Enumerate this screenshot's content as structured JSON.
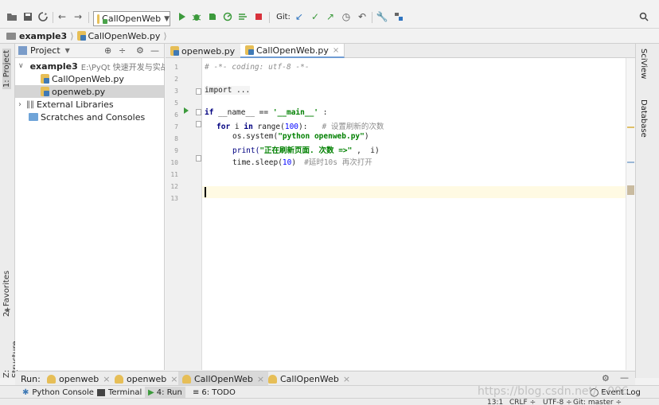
{
  "toolbar": {
    "run_config": "CallOpenWeb",
    "git_label": "Git:",
    "icons": [
      "open-folder-icon",
      "save-icon",
      "sync-icon",
      "back-arrow-icon",
      "forward-arrow-icon",
      "run-icon",
      "debug-icon",
      "coverage-icon",
      "profile-icon",
      "concurrency-icon",
      "stop-icon",
      "vcs-update-icon",
      "vcs-commit-icon",
      "vcs-push-icon",
      "history-icon",
      "revert-icon",
      "wrench-icon",
      "structure-icon",
      "search-icon"
    ]
  },
  "breadcrumb": {
    "project": "example3",
    "file": "CallOpenWeb.py"
  },
  "left_stripe": {
    "project": "1: Project",
    "favorites": "2: Favorites",
    "structure": "Z: Structure"
  },
  "right_stripe": {
    "sciview": "SciView",
    "database": "Database"
  },
  "project_panel": {
    "title": "Project",
    "root_name": "example3",
    "root_path": "E:\\PyQt 快速开发与实战\\P",
    "files": [
      "CallOpenWeb.py",
      "openweb.py"
    ],
    "external": "External Libraries",
    "scratches": "Scratches and Consoles"
  },
  "editor": {
    "tabs": [
      "openweb.py",
      "CallOpenWeb.py"
    ],
    "active_tab": 1,
    "line_numbers": [
      "1",
      "2",
      "3",
      "5",
      "6",
      "7",
      "8",
      "9",
      "10",
      "11",
      "12",
      "13"
    ],
    "code": {
      "l1": "# -*- coding: utf-8 -*-",
      "l3_import": "import",
      "l3_rest": " ...",
      "l6_if": "if",
      "l6_name": " __name__ == ",
      "l6_main": "'__main__'",
      "l6_colon": " :",
      "l7_for": "for",
      "l7_i": " i ",
      "l7_in": "in",
      "l7_range": " range(",
      "l7_num": "100",
      "l7_close": "):",
      "l7_comment": "# 设置刷新的次数",
      "l8_call": "os.system(",
      "l8_str": "\"python openweb.py\"",
      "l8_close": ")",
      "l9_print": "print(",
      "l9_str": "\"正在刷新页面. 次数 =>\"",
      "l9_rest": " ,  i)",
      "l10_call": "time.sleep(",
      "l10_num": "10",
      "l10_close": ")",
      "l10_comment": "#延时10s 再次打开"
    }
  },
  "run_bar": {
    "label": "Run:",
    "tabs": [
      "openweb",
      "openweb",
      "CallOpenWeb",
      "CallOpenWeb"
    ],
    "active_tab": 2
  },
  "bottom_tools": {
    "python_console": "Python Console",
    "terminal": "Terminal",
    "run": "4: Run",
    "todo": "6: TODO",
    "event_log": "Event Log"
  },
  "status": {
    "position": "13:1",
    "line_sep": "CRLF ÷",
    "encoding": "UTF-8 ÷",
    "git": "Git: master ÷"
  },
  "watermark": "https://blog.csdn.net/...006"
}
